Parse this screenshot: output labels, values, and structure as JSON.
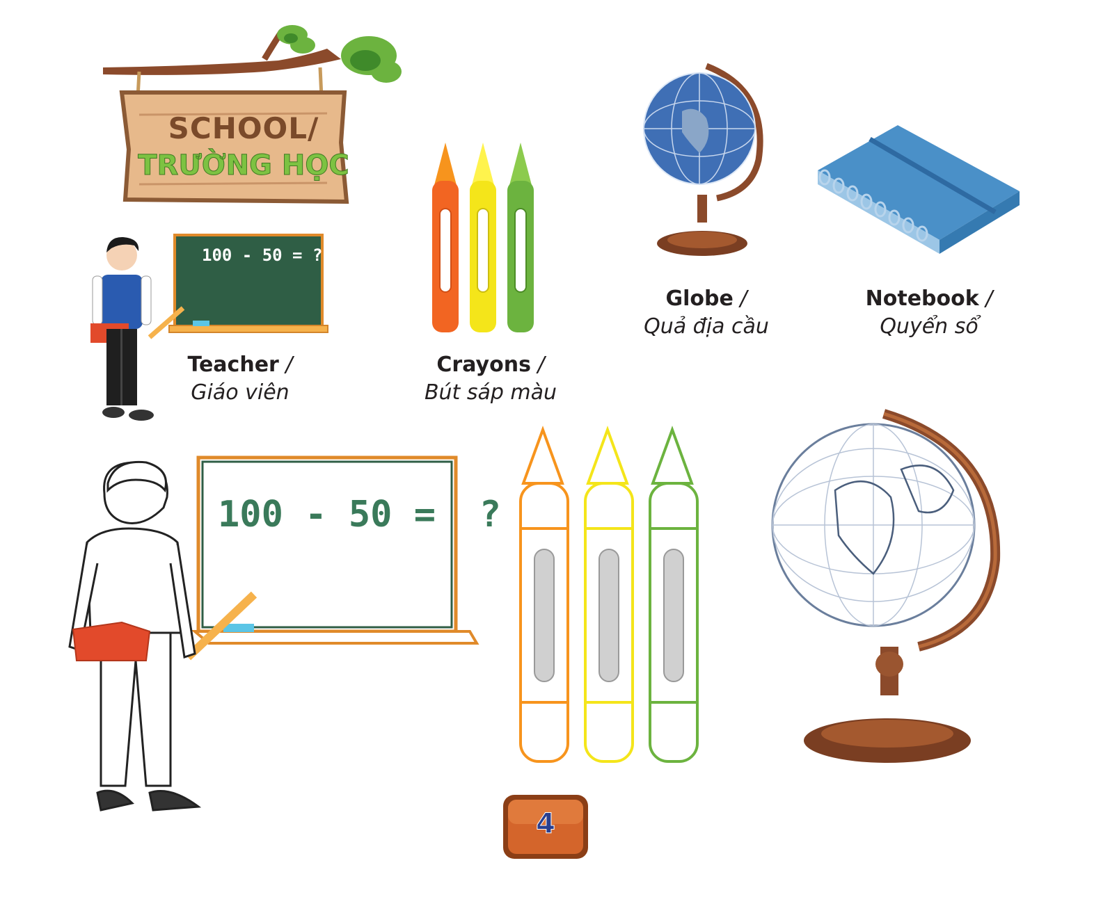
{
  "sign": {
    "line1": "SCHOOL/",
    "line2": "TRƯỜNG HỌC"
  },
  "items": [
    {
      "id": "teacher",
      "en": "Teacher",
      "sep": " /",
      "vi": "Giáo viên"
    },
    {
      "id": "crayons",
      "en": "Crayons",
      "sep": " /",
      "vi": "Bút sáp màu"
    },
    {
      "id": "globe",
      "en": "Globe",
      "sep": " /",
      "vi": "Quả địa cầu"
    },
    {
      "id": "notebook",
      "en": "Notebook",
      "sep": " /",
      "vi": "Quyển sổ"
    }
  ],
  "board_small": {
    "equation": "100 - 50 = ?"
  },
  "board_large": {
    "equation": "100 - 50 =  ?"
  },
  "page_number": "4",
  "colors": {
    "sign_brown": "#7a4a2a",
    "sign_green": "#7dc242",
    "board_green": "#2f5e45",
    "crayon_orange": "#f26522",
    "crayon_yellow": "#f4e51a",
    "crayon_green": "#6cb33f",
    "notebook_blue": "#4a90c8",
    "page_badge": "#c2521f"
  }
}
